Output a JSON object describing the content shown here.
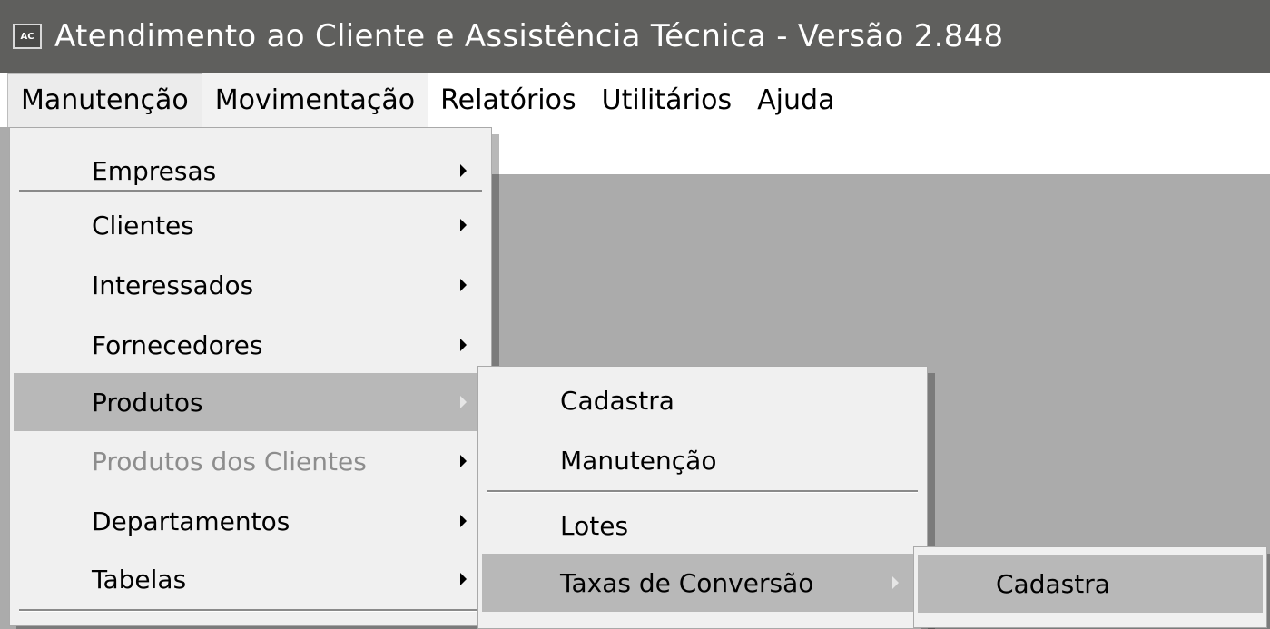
{
  "titlebar": {
    "icon_text": "AC",
    "title": "Atendimento ao Cliente e Assistência Técnica - Versão 2.848"
  },
  "menubar": {
    "items": [
      "Manutenção",
      "Movimentação",
      "Relatórios",
      "Utilitários",
      "Ajuda"
    ]
  },
  "menu_manutencao": {
    "items": [
      "Empresas",
      "Clientes",
      "Interessados",
      "Fornecedores",
      "Produtos",
      "Produtos dos Clientes",
      "Departamentos",
      "Tabelas"
    ]
  },
  "menu_produtos": {
    "items": [
      "Cadastra",
      "Manutenção",
      "Lotes",
      "Taxas de Conversão"
    ]
  },
  "menu_taxas": {
    "items": [
      "Cadastra"
    ]
  },
  "colors": {
    "titlebar_bg": "#5f5f5d",
    "desktop_bg": "#ababab",
    "menu_bg": "#f0f0f0",
    "highlight_bg": "#b8b8b8",
    "disabled_text": "#8d8d8d"
  }
}
